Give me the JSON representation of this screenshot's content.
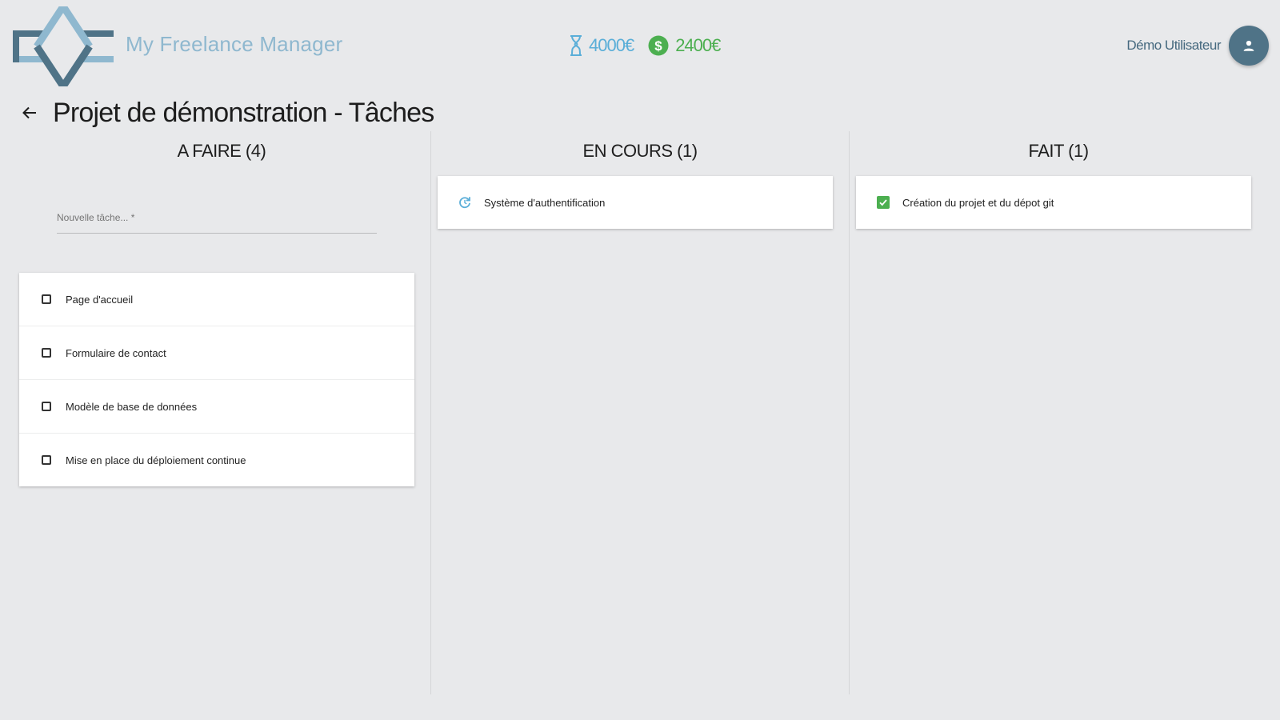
{
  "app": {
    "title": "My Freelance Manager"
  },
  "stats": {
    "pending": {
      "icon": "hourglass-icon",
      "value": "4000€",
      "color": "#5aaed8"
    },
    "paid": {
      "icon": "dollar-circle-icon",
      "value": "2400€",
      "color": "#4caf50"
    }
  },
  "user": {
    "name": "Démo Utilisateur",
    "avatar_icon": "person-icon"
  },
  "page": {
    "title": "Projet de démonstration - Tâches",
    "back_icon": "arrow-back-icon"
  },
  "columns": {
    "todo": {
      "title": "A FAIRE (4)",
      "new_task_placeholder": "Nouvelle tâche... *",
      "tasks": [
        {
          "label": "Page d'accueil"
        },
        {
          "label": "Formulaire de contact"
        },
        {
          "label": "Modèle de base de données"
        },
        {
          "label": "Mise en place du déploiement continue"
        }
      ]
    },
    "in_progress": {
      "title": "EN COURS (1)",
      "tasks": [
        {
          "label": "Système d'authentification",
          "icon": "refresh-icon"
        }
      ]
    },
    "done": {
      "title": "FAIT (1)",
      "tasks": [
        {
          "label": "Création du projet et du dépot git",
          "icon": "checkbox-checked-icon"
        }
      ]
    }
  },
  "colors": {
    "accent": "#4f7387",
    "logo_light": "#8fb8cf",
    "success": "#4caf50",
    "background": "#e8e9eb"
  }
}
